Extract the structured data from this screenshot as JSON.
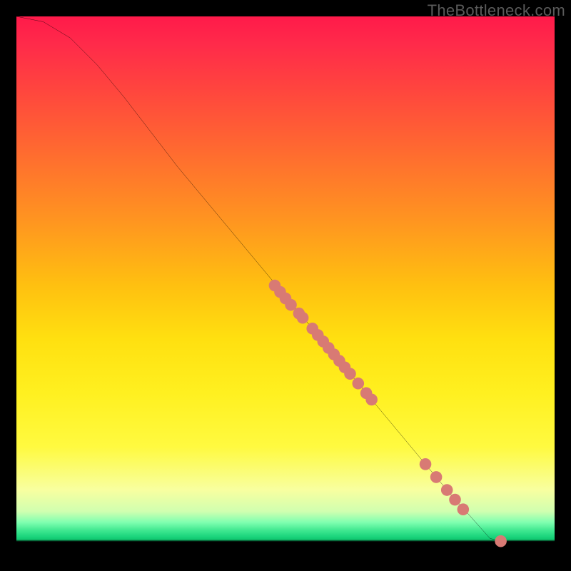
{
  "watermark": "TheBottleneck.com",
  "chart_data": {
    "type": "line",
    "title": "",
    "xlabel": "",
    "ylabel": "",
    "xlim": [
      0,
      100
    ],
    "ylim": [
      0,
      100
    ],
    "grid": false,
    "legend": false,
    "curve": [
      {
        "x": 0,
        "y": 100
      },
      {
        "x": 5,
        "y": 99
      },
      {
        "x": 10,
        "y": 96
      },
      {
        "x": 15,
        "y": 91
      },
      {
        "x": 20,
        "y": 85
      },
      {
        "x": 30,
        "y": 72
      },
      {
        "x": 40,
        "y": 60
      },
      {
        "x": 50,
        "y": 48
      },
      {
        "x": 60,
        "y": 36
      },
      {
        "x": 70,
        "y": 24
      },
      {
        "x": 80,
        "y": 12
      },
      {
        "x": 88,
        "y": 3
      },
      {
        "x": 90,
        "y": 2.5
      },
      {
        "x": 100,
        "y": 2.5
      }
    ],
    "points": [
      {
        "x": 48,
        "y": 50.0
      },
      {
        "x": 49,
        "y": 48.8
      },
      {
        "x": 50,
        "y": 47.6
      },
      {
        "x": 51,
        "y": 46.4
      },
      {
        "x": 52.5,
        "y": 44.8
      },
      {
        "x": 53.2,
        "y": 44.0
      },
      {
        "x": 55,
        "y": 42.0
      },
      {
        "x": 56,
        "y": 40.8
      },
      {
        "x": 57,
        "y": 39.6
      },
      {
        "x": 58,
        "y": 38.4
      },
      {
        "x": 59,
        "y": 37.2
      },
      {
        "x": 60,
        "y": 36.0
      },
      {
        "x": 61,
        "y": 34.8
      },
      {
        "x": 62,
        "y": 33.6
      },
      {
        "x": 63.5,
        "y": 31.8
      },
      {
        "x": 65,
        "y": 30.0
      },
      {
        "x": 66,
        "y": 28.8
      },
      {
        "x": 76,
        "y": 16.8
      },
      {
        "x": 78,
        "y": 14.4
      },
      {
        "x": 80,
        "y": 12.0
      },
      {
        "x": 81.5,
        "y": 10.2
      },
      {
        "x": 83,
        "y": 8.4
      },
      {
        "x": 90,
        "y": 2.5
      }
    ],
    "point_color": "#d87a74",
    "line_color": "#000000"
  }
}
